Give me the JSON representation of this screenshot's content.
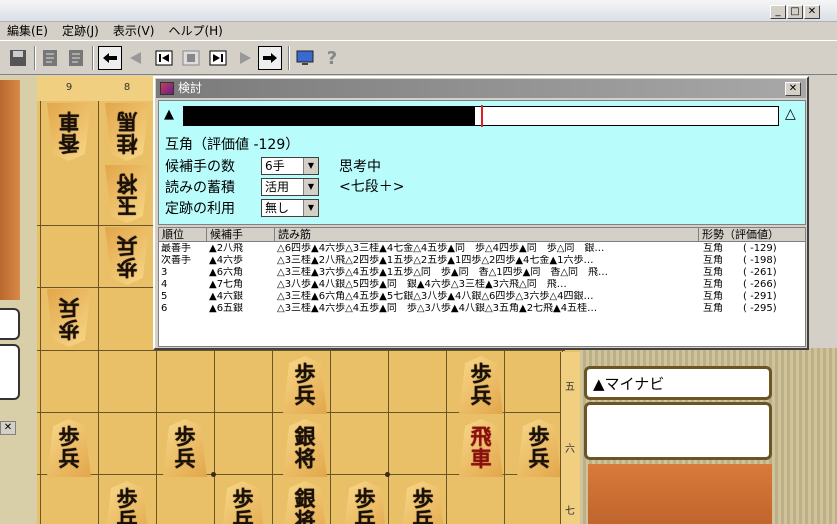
{
  "window": {
    "btn_min": "_",
    "btn_max": "□",
    "btn_close": "✕"
  },
  "menu": [
    "編集(E)",
    "定跡(J)",
    "表示(V)",
    "ヘルプ(H)"
  ],
  "toolbar_icons": [
    "save-icon",
    "book-icon",
    "book-icon",
    "prev-icon",
    "back-icon",
    "first-icon",
    "stop-icon",
    "last-icon",
    "forward-icon",
    "next-icon",
    "monitor-icon",
    "help-icon"
  ],
  "toolbar_glyphs": {
    "help": "?",
    "monitor": "▭"
  },
  "board": {
    "files": [
      "9",
      "8"
    ],
    "ranks": [
      "五",
      "六",
      "七"
    ]
  },
  "pieces": [
    {
      "name": "piece-kyosha-gote",
      "lines": [
        "香",
        "車"
      ],
      "gote": true,
      "promo": false
    },
    {
      "name": "piece-keima-gote",
      "lines": [
        "桂",
        "馬"
      ],
      "gote": true,
      "promo": false
    },
    {
      "name": "piece-king-gote",
      "lines": [
        "玉",
        "将"
      ],
      "gote": true,
      "promo": false
    },
    {
      "name": "piece-fuhyo-gote",
      "lines": [
        "歩",
        "兵"
      ],
      "gote": true,
      "promo": false
    },
    {
      "name": "piece-fuhyo-gote",
      "lines": [
        "歩",
        "兵"
      ],
      "gote": true,
      "promo": false
    },
    {
      "name": "piece-fuhyo",
      "lines": [
        "歩",
        "兵"
      ],
      "gote": false,
      "promo": false
    },
    {
      "name": "piece-fuhyo",
      "lines": [
        "歩",
        "兵"
      ],
      "gote": false,
      "promo": false
    },
    {
      "name": "piece-fuhyo",
      "lines": [
        "歩",
        "兵"
      ],
      "gote": false,
      "promo": false
    },
    {
      "name": "piece-fuhyo",
      "lines": [
        "歩",
        "兵"
      ],
      "gote": false,
      "promo": false
    },
    {
      "name": "piece-ginsho",
      "lines": [
        "銀",
        "将"
      ],
      "gote": false,
      "promo": false
    },
    {
      "name": "piece-hisha",
      "lines": [
        "飛",
        "車"
      ],
      "gote": false,
      "promo": true
    },
    {
      "name": "piece-fuhyo",
      "lines": [
        "歩",
        "兵"
      ],
      "gote": false,
      "promo": false
    },
    {
      "name": "piece-fuhyo",
      "lines": [
        "歩",
        "兵"
      ],
      "gote": false,
      "promo": false
    },
    {
      "name": "piece-fuhyo",
      "lines": [
        "歩",
        "兵"
      ],
      "gote": false,
      "promo": false
    },
    {
      "name": "piece-ginsho",
      "lines": [
        "銀",
        "将"
      ],
      "gote": false,
      "promo": false
    },
    {
      "name": "piece-fuhyo",
      "lines": [
        "歩",
        "兵"
      ],
      "gote": false,
      "promo": false
    },
    {
      "name": "piece-fuhyo",
      "lines": [
        "歩",
        "兵"
      ],
      "gote": false,
      "promo": false
    }
  ],
  "player": {
    "name": "▲マイナビ"
  },
  "dialog": {
    "title": "検討",
    "close": "✕",
    "eval_mark_left": "▲",
    "eval_mark_right": "△",
    "eval_fill_fraction": 0.49,
    "eval_zero_fraction": 0.5,
    "status": "互角（評価値 -129）",
    "options": [
      {
        "label": "候補手の数",
        "value": "6手"
      },
      {
        "label": "読みの蓄積",
        "value": "活用"
      },
      {
        "label": "定跡の利用",
        "value": "無し"
      }
    ],
    "thinking": "思考中",
    "engine": "<七段＋>",
    "columns": [
      "順位",
      "候補手",
      "読み筋",
      "形勢（評価値）"
    ],
    "rows": [
      {
        "rank": "最善手",
        "move": "▲2八飛",
        "pv": "△6四歩▲4六歩△3三桂▲4七金△4五歩▲同　歩△4四歩▲同　歩△同　銀…",
        "judge": "互角",
        "score": "(  -129)"
      },
      {
        "rank": "次善手",
        "move": "▲4六歩",
        "pv": "△3三桂▲2八飛△2四歩▲1五歩△2五歩▲1四歩△2四歩▲4七金▲1六歩…",
        "judge": "互角",
        "score": "(  -198)"
      },
      {
        "rank": "3",
        "move": "▲6六角",
        "pv": "△3三桂▲3六歩△4五歩▲1五歩△同　歩▲同　香△1四歩▲同　香△同　飛…",
        "judge": "互角",
        "score": "(  -261)"
      },
      {
        "rank": "4",
        "move": "▲7七角",
        "pv": "△3八歩▲4八銀△5四歩▲同　銀▲4六歩△3三桂▲3六飛△同　飛…",
        "judge": "互角",
        "score": "(  -266)"
      },
      {
        "rank": "5",
        "move": "▲4六銀",
        "pv": "△3三桂▲6六角△4五歩▲5七銀△3八歩▲4八銀△6四歩△3六歩△4四銀…",
        "judge": "互角",
        "score": "(  -291)"
      },
      {
        "rank": "6",
        "move": "▲6五銀",
        "pv": "△3三桂▲4六歩△4五歩▲同　歩△3八歩▲4八銀△3五角▲2七飛▲4五桂…",
        "judge": "互角",
        "score": "(  -295)"
      }
    ]
  }
}
